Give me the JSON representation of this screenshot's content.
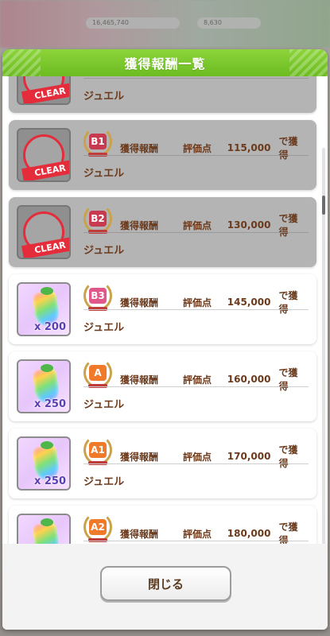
{
  "modal": {
    "title": "獲得報酬一覧",
    "close_label": "閉じる"
  },
  "background": {
    "chip_left": "16,465,740",
    "chip_right": "8,630"
  },
  "rewards": [
    {
      "rank": "",
      "reward_label": "",
      "score_label": "",
      "score": "",
      "suffix": "",
      "item": "ジュエル",
      "quantity": "",
      "cleared": true,
      "clear_text": "CLEAR",
      "rank_color": "#c83a4f"
    },
    {
      "rank": "B1",
      "reward_label": "獲得報酬",
      "score_label": "評価点",
      "score": "115,000",
      "suffix": "で獲得",
      "item": "ジュエル",
      "quantity": "",
      "cleared": true,
      "clear_text": "CLEAR",
      "rank_color": "#c83a4f"
    },
    {
      "rank": "B2",
      "reward_label": "獲得報酬",
      "score_label": "評価点",
      "score": "130,000",
      "suffix": "で獲得",
      "item": "ジュエル",
      "quantity": "",
      "cleared": true,
      "clear_text": "CLEAR",
      "rank_color": "#c83a4f"
    },
    {
      "rank": "B3",
      "reward_label": "獲得報酬",
      "score_label": "評価点",
      "score": "145,000",
      "suffix": "で獲得",
      "item": "ジュエル",
      "quantity": "x 200",
      "cleared": false,
      "clear_text": "",
      "rank_color": "#e0578a"
    },
    {
      "rank": "A",
      "reward_label": "獲得報酬",
      "score_label": "評価点",
      "score": "160,000",
      "suffix": "で獲得",
      "item": "ジュエル",
      "quantity": "x 250",
      "cleared": false,
      "clear_text": "",
      "rank_color": "#f07a2a"
    },
    {
      "rank": "A1",
      "reward_label": "獲得報酬",
      "score_label": "評価点",
      "score": "170,000",
      "suffix": "で獲得",
      "item": "ジュエル",
      "quantity": "x 250",
      "cleared": false,
      "clear_text": "",
      "rank_color": "#f07a2a"
    },
    {
      "rank": "A2",
      "reward_label": "獲得報酬",
      "score_label": "評価点",
      "score": "180,000",
      "suffix": "で獲得",
      "item": "",
      "quantity": "",
      "cleared": false,
      "clear_text": "",
      "rank_color": "#f07a2a"
    }
  ]
}
